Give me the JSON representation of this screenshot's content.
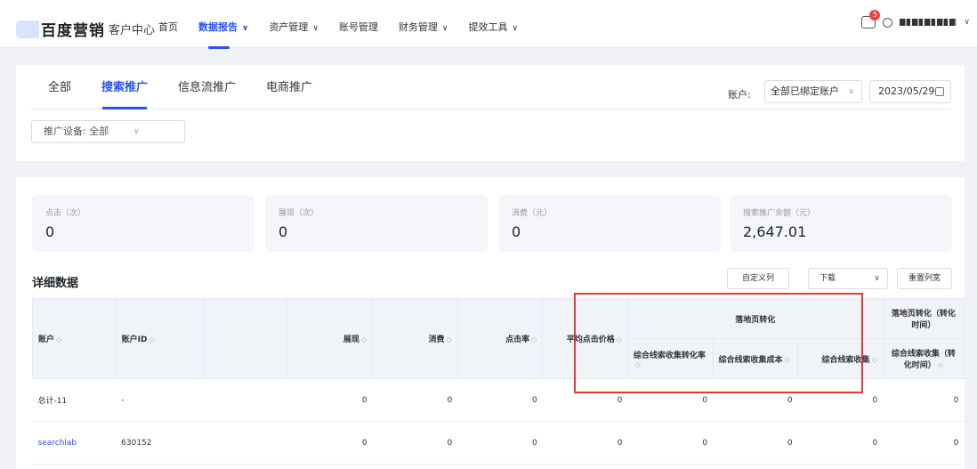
{
  "header": {
    "brand": "百度营销",
    "brand_sub": "客户中心",
    "nav": [
      {
        "label": "首页",
        "chev": ""
      },
      {
        "label": "数据报告",
        "chev": "∨"
      },
      {
        "label": "资产管理",
        "chev": "∨"
      },
      {
        "label": "账号管理",
        "chev": ""
      },
      {
        "label": "财务管理",
        "chev": "∨"
      },
      {
        "label": "提效工具",
        "chev": "∨"
      }
    ],
    "notification_count": "5",
    "user_chevron": "∨"
  },
  "filters": {
    "tabs": [
      "全部",
      "搜索推广",
      "信息流推广",
      "电商推广"
    ],
    "account_label": "账户:",
    "account_value": "全部已绑定账户",
    "date": "2023/05/29",
    "device": "推广设备: 全部",
    "chev": "∨"
  },
  "metrics": [
    {
      "label": "点击（次）",
      "value": "0"
    },
    {
      "label": "展现（次）",
      "value": "0"
    },
    {
      "label": "消费（元）",
      "value": "0"
    },
    {
      "label": "搜索推广余额（元）",
      "value": "2,647.01"
    }
  ],
  "detail": {
    "title": "详细数据",
    "custom_columns": "自定义列",
    "download": "下载",
    "reset_width": "重置列宽",
    "chev": "∨"
  },
  "table": {
    "sort_glyph": "◇",
    "group_header": "落地页转化",
    "group_header_2": "落地页转化（转化时间）",
    "columns": [
      "账户",
      "账户ID",
      "",
      "展现",
      "消费",
      "点击率",
      "平均点击价格",
      "综合线索收集转化率",
      "综合线索收集成本",
      "综合线索收集",
      "综合线索收集（转化时间）"
    ],
    "rows": [
      [
        "总计-11",
        "-",
        "",
        "0",
        "0",
        "0",
        "0",
        "0",
        "0",
        "0",
        "0"
      ],
      [
        "searchlab",
        "630152",
        "",
        "0",
        "0",
        "0",
        "0",
        "0",
        "0",
        "0",
        "0"
      ]
    ]
  },
  "colors": {
    "accent": "#2753f5",
    "highlight": "#e53935",
    "badge": "#f04134"
  }
}
